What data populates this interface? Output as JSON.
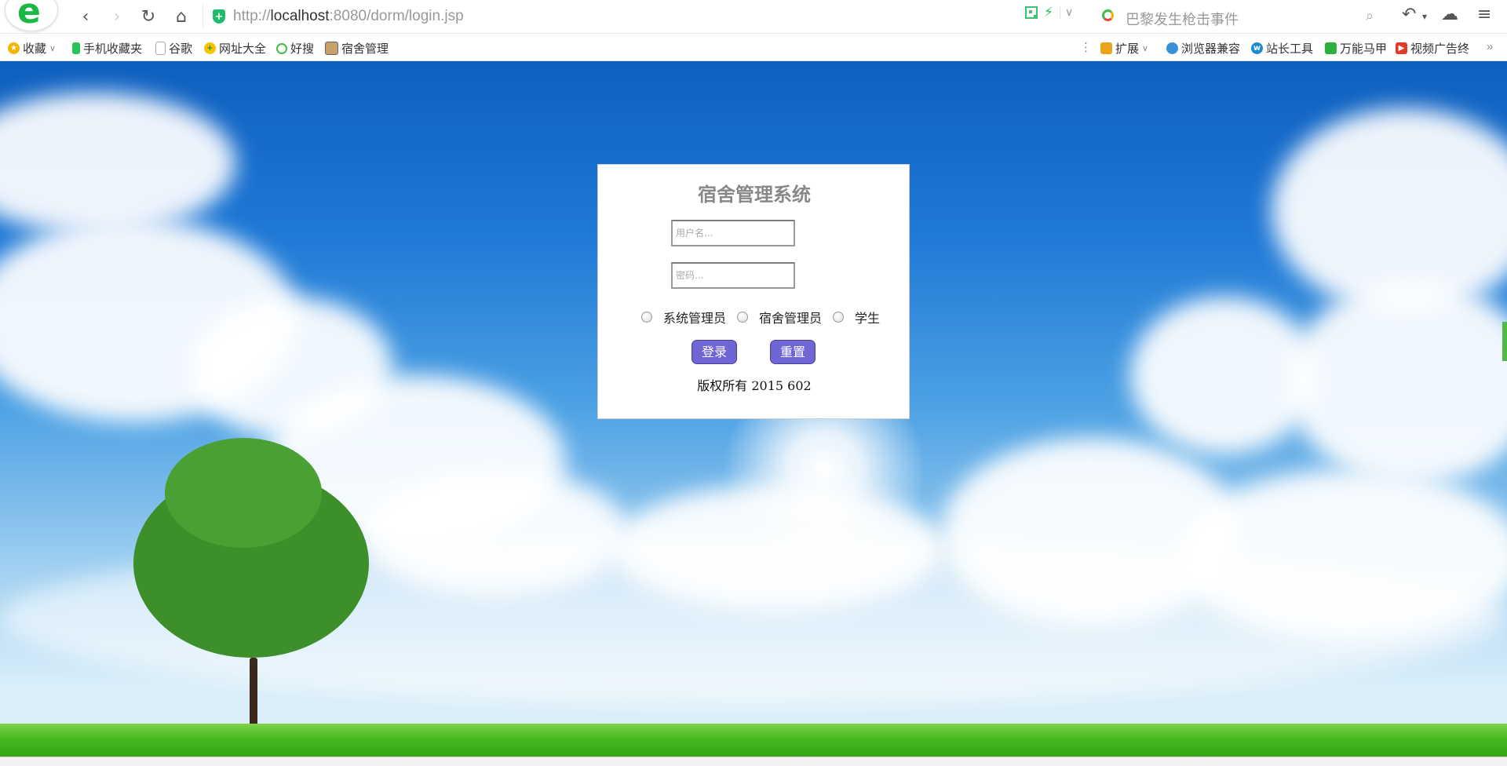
{
  "browser": {
    "url_scheme": "http://",
    "url_host": "localhost",
    "url_path": ":8080/dorm/login.jsp",
    "search_placeholder": "巴黎发生枪击事件",
    "bookmarks": [
      {
        "label": "收藏",
        "icon": "star-icon"
      },
      {
        "label": "手机收藏夹",
        "icon": "phone-icon"
      },
      {
        "label": "谷歌",
        "icon": "page-icon"
      },
      {
        "label": "网址大全",
        "icon": "nav-icon"
      },
      {
        "label": "好搜",
        "icon": "search-logo-icon"
      },
      {
        "label": "宿舍管理",
        "icon": "image-icon"
      }
    ],
    "extensions": [
      {
        "label": "扩展",
        "icon": "apps-icon"
      },
      {
        "label": "浏览器兼容",
        "icon": "compat-icon"
      },
      {
        "label": "站长工具",
        "icon": "webmaster-icon"
      },
      {
        "label": "万能马甲",
        "icon": "vest-icon"
      },
      {
        "label": "视频广告终",
        "icon": "video-icon"
      }
    ],
    "colors": {
      "accent": "#1bb845",
      "button": "#6f66d6"
    }
  },
  "login": {
    "title": "宿舍管理系统",
    "username_placeholder": "用户名...",
    "password_placeholder": "密码...",
    "roles": [
      "系统管理员",
      "宿舍管理员",
      "学生"
    ],
    "login_label": "登录",
    "reset_label": "重置",
    "copyright": "版权所有 2015 602"
  }
}
